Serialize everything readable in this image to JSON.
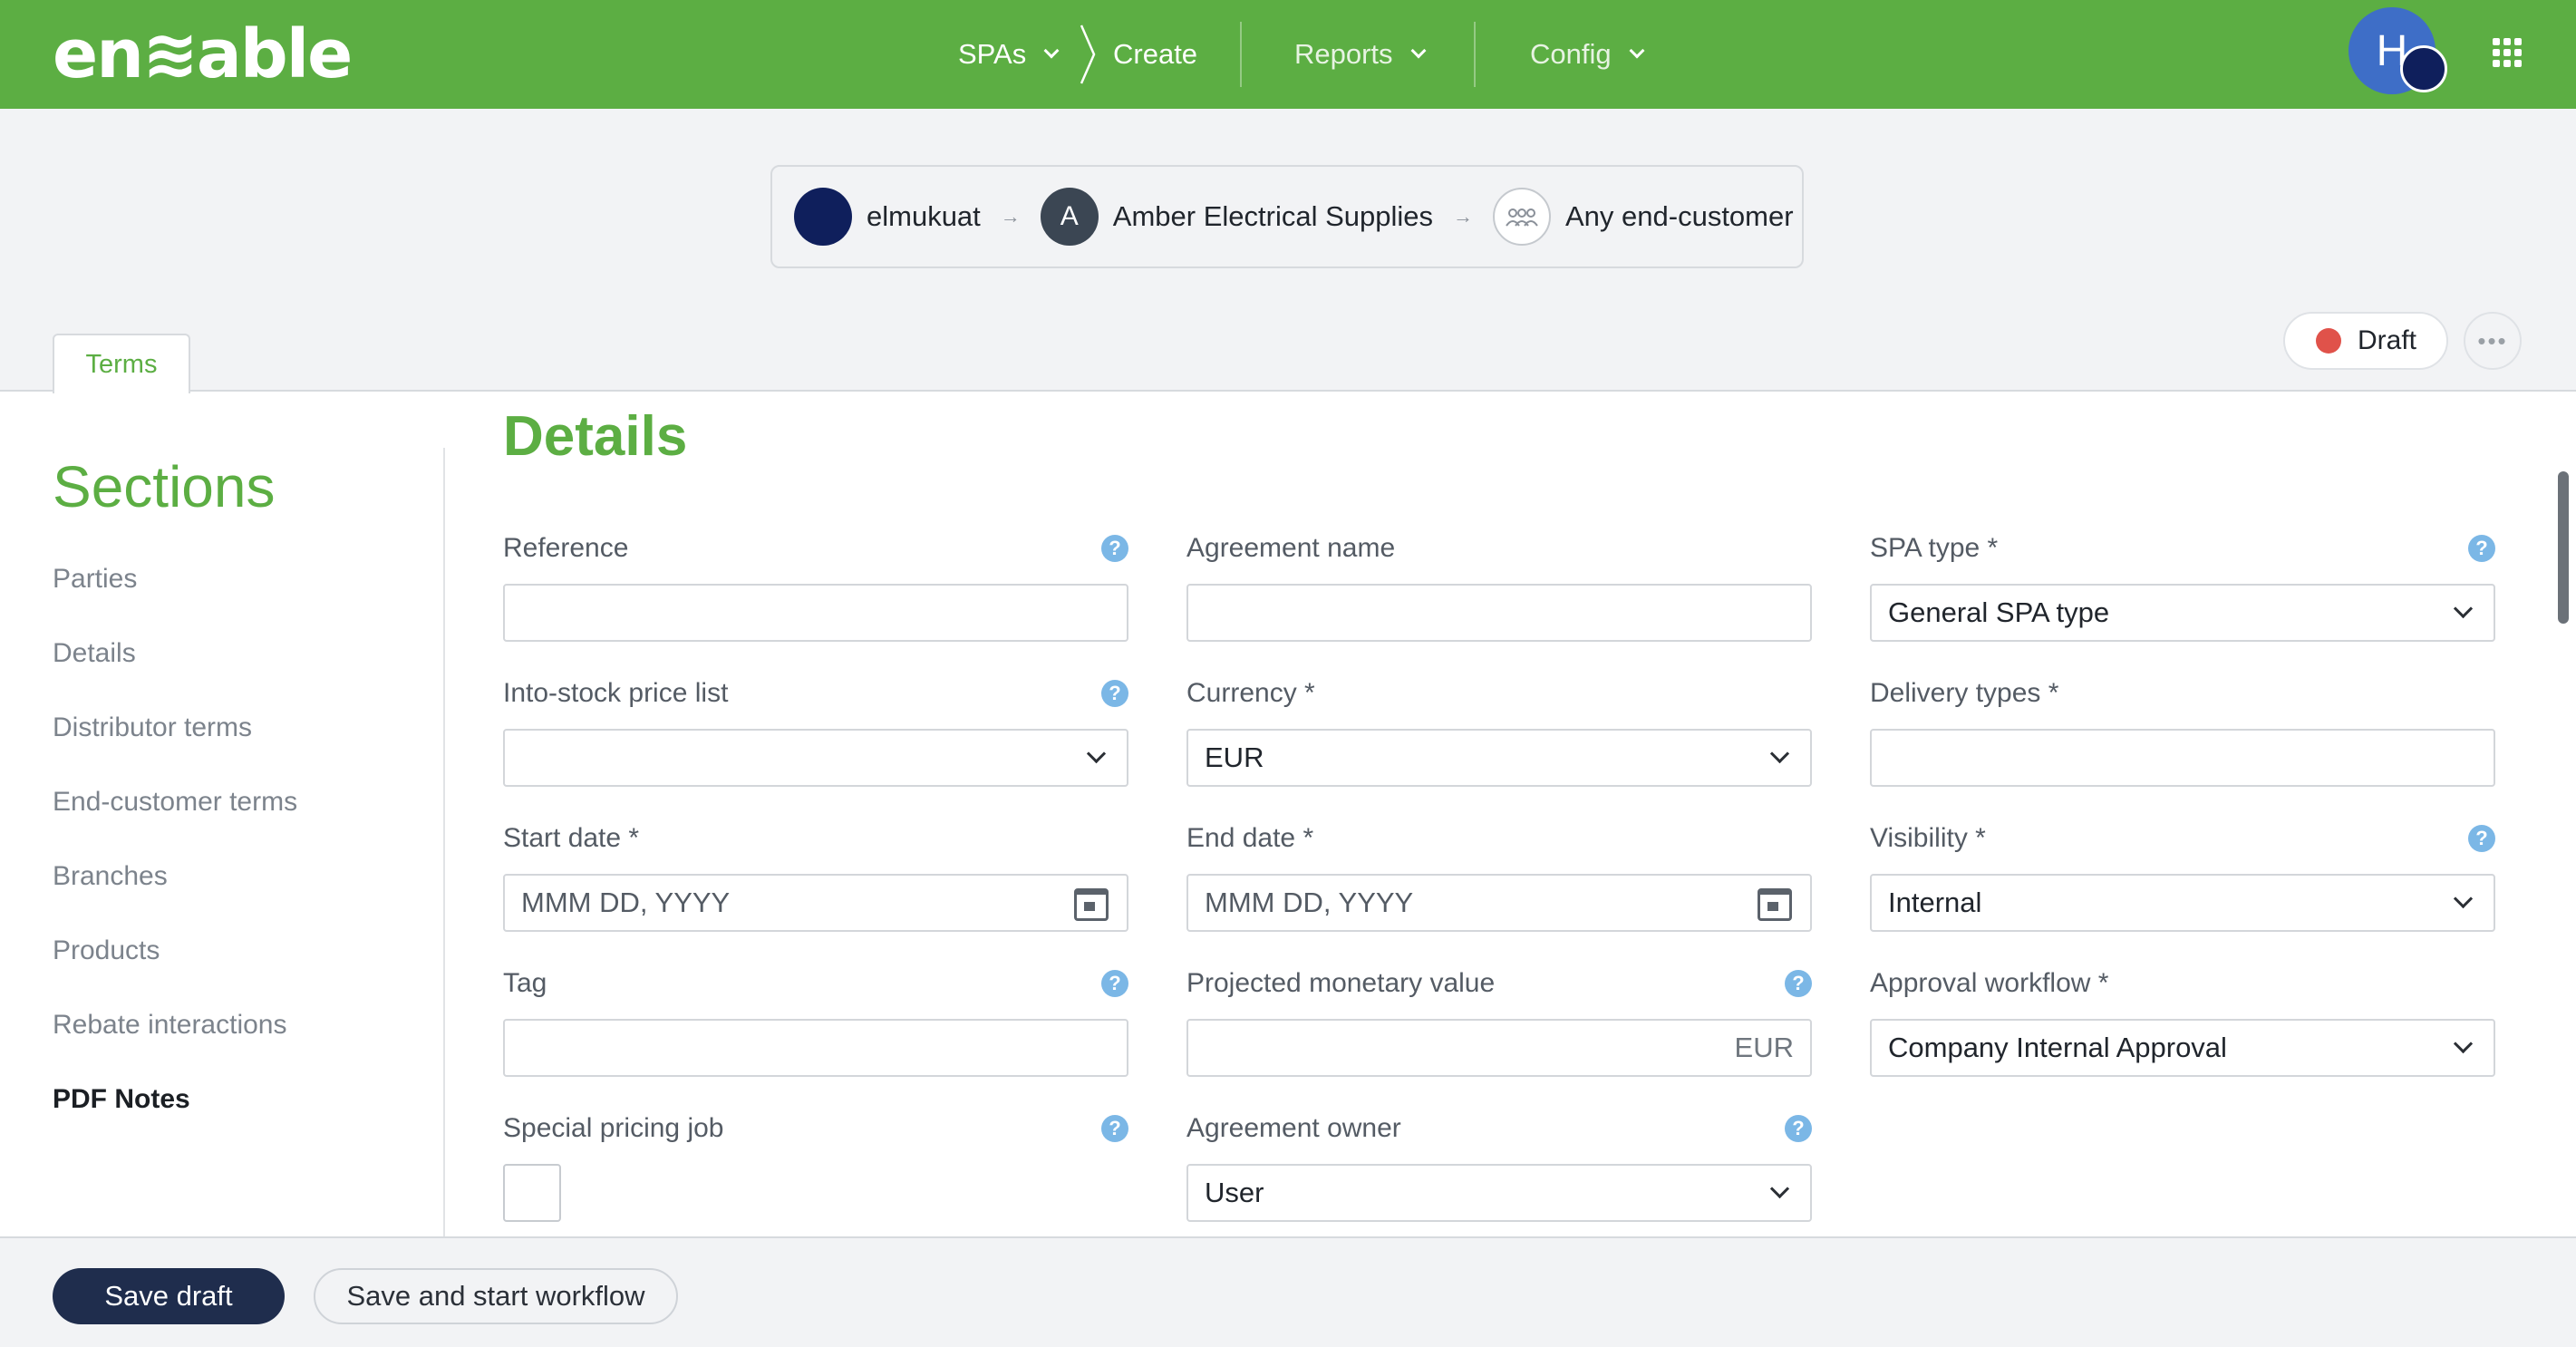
{
  "header": {
    "logo_text": "en≋able",
    "nav": {
      "spas": "SPAs",
      "create": "Create",
      "reports": "Reports",
      "config": "Config"
    },
    "avatar_initial": "H"
  },
  "parties": {
    "items": [
      {
        "name": "elmukuat",
        "initial": ""
      },
      {
        "name": "Amber Electrical Supplies",
        "initial": "A"
      },
      {
        "name": "Any end-customer",
        "initial": ""
      }
    ]
  },
  "tabs": {
    "terms": "Terms"
  },
  "status": {
    "label": "Draft",
    "color": "#e0524a"
  },
  "sections": {
    "title": "Sections",
    "items": [
      "Parties",
      "Details",
      "Distributor terms",
      "End-customer terms",
      "Branches",
      "Products",
      "Rebate interactions",
      "PDF Notes"
    ],
    "active": "PDF Notes"
  },
  "details": {
    "title": "Details",
    "fields": {
      "reference": {
        "label": "Reference",
        "value": ""
      },
      "agreement_name": {
        "label": "Agreement name",
        "value": ""
      },
      "spa_type": {
        "label": "SPA type *",
        "value": "General SPA type"
      },
      "into_stock": {
        "label": "Into-stock price list",
        "value": ""
      },
      "currency": {
        "label": "Currency *",
        "value": "EUR"
      },
      "delivery_types": {
        "label": "Delivery types *",
        "value": ""
      },
      "start_date": {
        "label": "Start date *",
        "placeholder": "MMM DD, YYYY"
      },
      "end_date": {
        "label": "End date *",
        "placeholder": "MMM DD, YYYY"
      },
      "visibility": {
        "label": "Visibility *",
        "value": "Internal"
      },
      "tag": {
        "label": "Tag",
        "value": ""
      },
      "projected_value": {
        "label": "Projected monetary value",
        "suffix": "EUR"
      },
      "approval_workflow": {
        "label": "Approval workflow *",
        "value": "Company Internal Approval"
      },
      "special_pricing": {
        "label": "Special pricing job"
      },
      "agreement_owner": {
        "label": "Agreement owner",
        "value": "User"
      }
    }
  },
  "footer": {
    "save_draft": "Save draft",
    "save_workflow": "Save and start workflow"
  },
  "colors": {
    "brand_green": "#5cae43",
    "primary_button": "#1f2d4d",
    "help_icon": "#7bb7e6"
  }
}
